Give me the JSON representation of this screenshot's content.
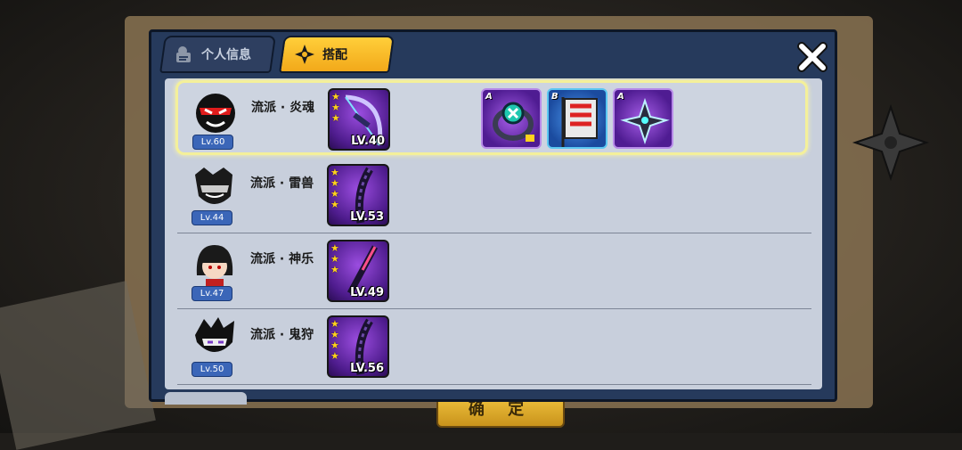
{
  "tabs": {
    "profile": "个人信息",
    "outfit": "搭配"
  },
  "confirm_button": "确 定",
  "rows": [
    {
      "level": "Lv.60",
      "school": "流派 · 炎魂",
      "weapon_level": "LV.40",
      "stars": 3,
      "equipment": [
        {
          "rank": "A",
          "item": "ring-icon"
        },
        {
          "rank": "B",
          "item": "banner-icon"
        },
        {
          "rank": "A",
          "item": "shuriken-icon"
        }
      ]
    },
    {
      "level": "Lv.44",
      "school": "流派 · 雷兽",
      "weapon_level": "LV.53",
      "stars": 4,
      "equipment": []
    },
    {
      "level": "Lv.47",
      "school": "流派 · 神乐",
      "weapon_level": "LV.49",
      "stars": 3,
      "equipment": []
    },
    {
      "level": "Lv.50",
      "school": "流派 · 鬼狩",
      "weapon_level": "LV.56",
      "stars": 4,
      "equipment": []
    }
  ],
  "colors": {
    "accent": "#f2a91a",
    "selected_border": "#f4f09a",
    "panel": "#c8cfdc"
  }
}
